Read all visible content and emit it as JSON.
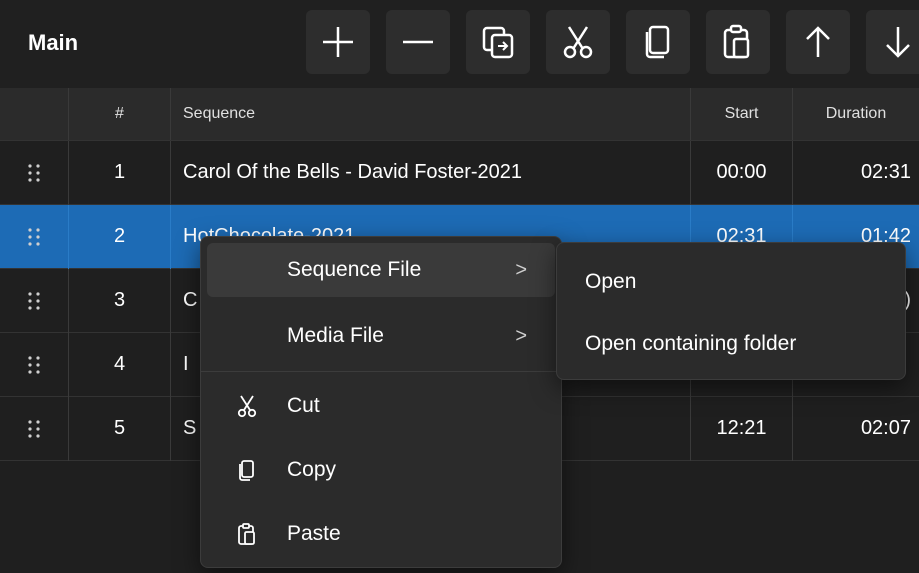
{
  "panel": {
    "title": "Main"
  },
  "toolbar": {
    "buttons": [
      {
        "name": "add-button",
        "icon": "plus-icon"
      },
      {
        "name": "remove-button",
        "icon": "minus-icon"
      },
      {
        "name": "duplicate-button",
        "icon": "duplicate-icon"
      },
      {
        "name": "cut-button",
        "icon": "scissors-icon"
      },
      {
        "name": "copy-button",
        "icon": "copy-icon"
      },
      {
        "name": "paste-button",
        "icon": "paste-icon"
      },
      {
        "name": "move-up-button",
        "icon": "arrow-up-icon"
      },
      {
        "name": "move-down-button",
        "icon": "arrow-down-icon"
      }
    ]
  },
  "table": {
    "columns": [
      "#",
      "Sequence",
      "Start",
      "Duration"
    ],
    "rows": [
      {
        "num": "1",
        "sequence": "Carol Of the Bells - David Foster-2021",
        "start": "00:00",
        "duration": "02:31"
      },
      {
        "num": "2",
        "sequence": "HotChocolate-2021",
        "start": "02:31",
        "duration": "01:42"
      },
      {
        "num": "3",
        "sequence": "C",
        "start": "",
        "duration": ")"
      },
      {
        "num": "4",
        "sequence": "I",
        "start": "",
        "duration": ""
      },
      {
        "num": "5",
        "sequence": "S",
        "start": "12:21",
        "duration": "02:07"
      }
    ],
    "selected_row": 2
  },
  "context_menu": {
    "items": [
      {
        "label": "Sequence File",
        "has_submenu": true
      },
      {
        "label": "Media File",
        "has_submenu": true
      },
      {
        "label": "Cut",
        "icon": "scissors-icon"
      },
      {
        "label": "Copy",
        "icon": "copy-icon"
      },
      {
        "label": "Paste",
        "icon": "paste-icon"
      }
    ],
    "chevron": ">"
  },
  "submenu": {
    "items": [
      "Open",
      "Open containing folder"
    ]
  },
  "colors": {
    "background": "#202020",
    "selected_row": "#1d6bb5",
    "menu": "#2b2b2b"
  }
}
